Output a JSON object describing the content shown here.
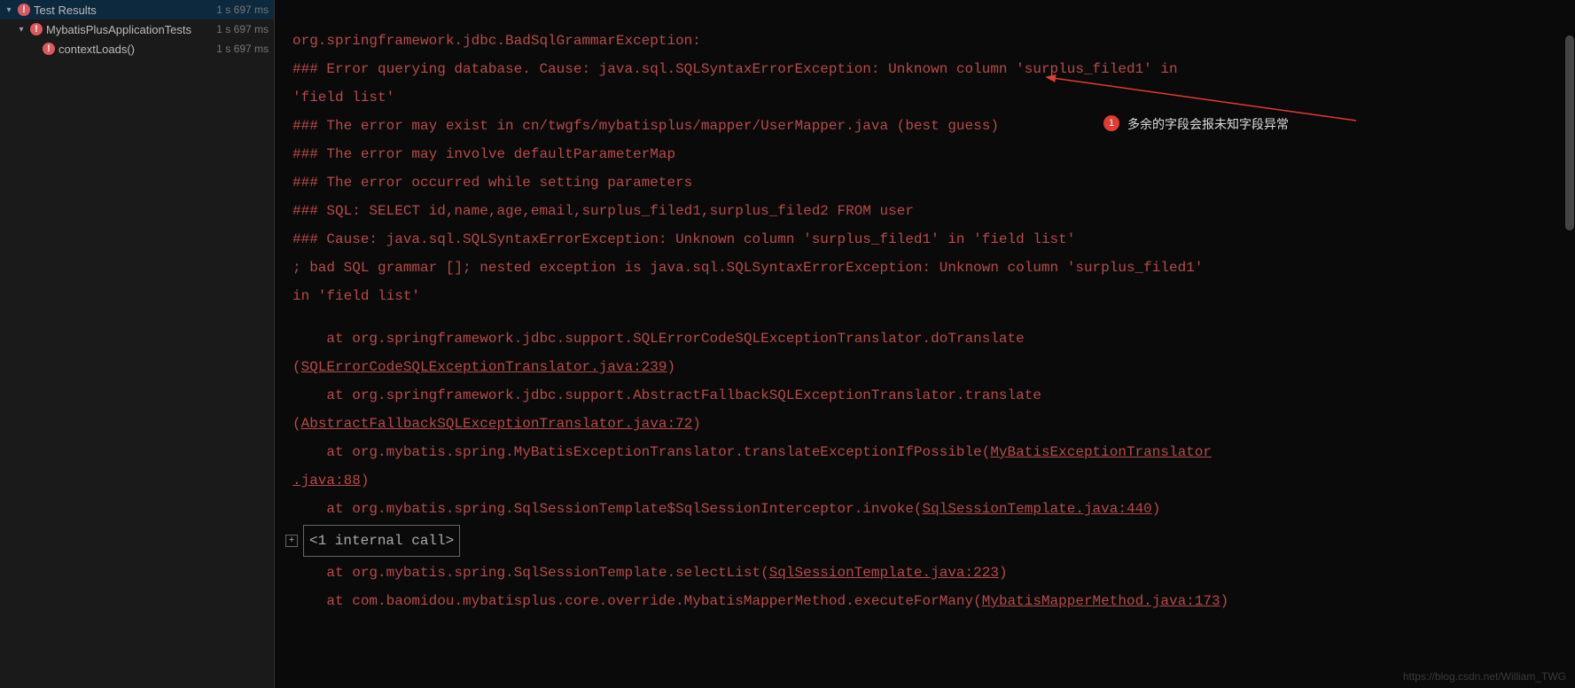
{
  "tree": {
    "root": {
      "label": "Test Results",
      "time": "1 s 697 ms"
    },
    "node1": {
      "label": "MybatisPlusApplicationTests",
      "time": "1 s 697 ms"
    },
    "node2": {
      "label": "contextLoads()",
      "time": "1 s 697 ms"
    }
  },
  "console": {
    "l1": "org.springframework.jdbc.BadSqlGrammarException: ",
    "l2": "### Error querying database.  Cause: java.sql.SQLSyntaxErrorException: Unknown column 'surplus_filed1' in",
    "l2b": " 'field list'",
    "l3": "### The error may exist in cn/twgfs/mybatisplus/mapper/UserMapper.java (best guess)",
    "l4": "### The error may involve defaultParameterMap",
    "l5": "### The error occurred while setting parameters",
    "l6": "### SQL: SELECT  id,name,age,email,surplus_filed1,surplus_filed2  FROM user",
    "l7": "### Cause: java.sql.SQLSyntaxErrorException: Unknown column 'surplus_filed1' in 'field list'",
    "l8": "; bad SQL grammar []; nested exception is java.sql.SQLSyntaxErrorException: Unknown column 'surplus_filed1'",
    "l8b": " in 'field list'",
    "st1_a": "    at org.springframework.jdbc.support.SQLErrorCodeSQLExceptionTranslator.doTranslate",
    "st1_c": "(",
    "st1_b": "SQLErrorCodeSQLExceptionTranslator.java:239",
    "st1_d": ")",
    "st2_a": "    at org.springframework.jdbc.support.AbstractFallbackSQLExceptionTranslator.translate",
    "st2_c": "(",
    "st2_b": "AbstractFallbackSQLExceptionTranslator.java:72",
    "st2_d": ")",
    "st3_a": "    at org.mybatis.spring.MyBatisExceptionTranslator.translateExceptionIfPossible(",
    "st3_b": "MyBatisExceptionTranslator",
    "st3_c": ".java:88",
    "st3_d": ")",
    "st4_a": "    at org.mybatis.spring.SqlSessionTemplate$SqlSessionInterceptor.invoke(",
    "st4_b": "SqlSessionTemplate.java:440",
    "st4_d": ")",
    "internal": "<1 internal call>",
    "st5_a": "    at org.mybatis.spring.SqlSessionTemplate.selectList(",
    "st5_b": "SqlSessionTemplate.java:223",
    "st5_d": ")",
    "st6_a": "    at com.baomidou.mybatisplus.core.override.MybatisMapperMethod.executeForMany(",
    "st6_b": "MybatisMapperMethod.java:173",
    "st6_d": ")"
  },
  "annotation": {
    "badge": "1",
    "text": "多余的字段会报未知字段异常"
  },
  "watermark": "https://blog.csdn.net/William_TWG"
}
